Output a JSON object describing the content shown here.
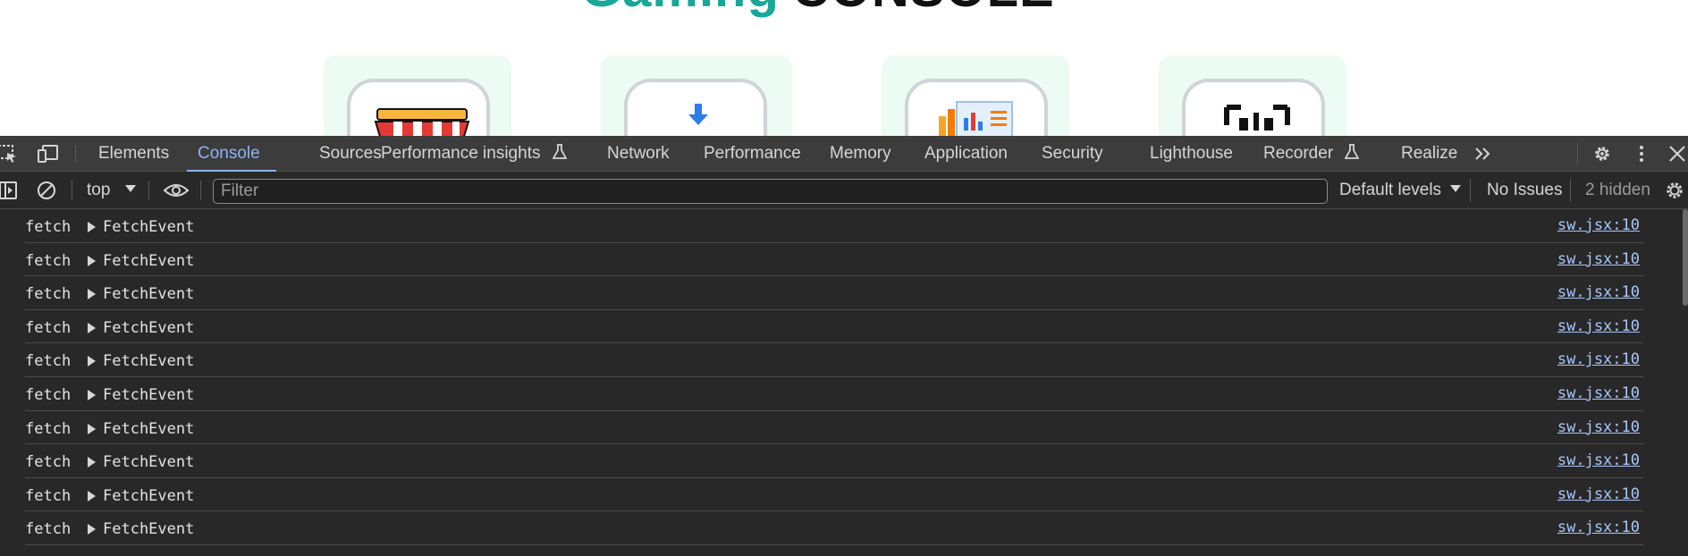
{
  "page": {
    "title_word1": "Gaming",
    "title_word2": "CONSOLE"
  },
  "devtools": {
    "tabs": [
      {
        "label": "Elements"
      },
      {
        "label": "Console"
      },
      {
        "label": "Sources"
      },
      {
        "label": "Performance insights"
      },
      {
        "label": "Network"
      },
      {
        "label": "Performance"
      },
      {
        "label": "Memory"
      },
      {
        "label": "Application"
      },
      {
        "label": "Security"
      },
      {
        "label": "Lighthouse"
      },
      {
        "label": "Recorder"
      },
      {
        "label": "Realize"
      }
    ],
    "active_tab": "Console",
    "toolbar": {
      "context": "top",
      "filter_placeholder": "Filter",
      "levels": "Default levels",
      "issues": "No Issues",
      "hidden": "2 hidden"
    },
    "log_rows": [
      {
        "message": "fetch",
        "object": "FetchEvent",
        "source": "sw.jsx:10"
      },
      {
        "message": "fetch",
        "object": "FetchEvent",
        "source": "sw.jsx:10"
      },
      {
        "message": "fetch",
        "object": "FetchEvent",
        "source": "sw.jsx:10"
      },
      {
        "message": "fetch",
        "object": "FetchEvent",
        "source": "sw.jsx:10"
      },
      {
        "message": "fetch",
        "object": "FetchEvent",
        "source": "sw.jsx:10"
      },
      {
        "message": "fetch",
        "object": "FetchEvent",
        "source": "sw.jsx:10"
      },
      {
        "message": "fetch",
        "object": "FetchEvent",
        "source": "sw.jsx:10"
      },
      {
        "message": "fetch",
        "object": "FetchEvent",
        "source": "sw.jsx:10"
      },
      {
        "message": "fetch",
        "object": "FetchEvent",
        "source": "sw.jsx:10"
      },
      {
        "message": "fetch",
        "object": "FetchEvent",
        "source": "sw.jsx:10"
      }
    ],
    "colors": {
      "accent": "#8ab4f8",
      "link": "#a9c7fa",
      "panel_bg": "#282828",
      "tabbar_bg": "#3c3c3c"
    }
  }
}
